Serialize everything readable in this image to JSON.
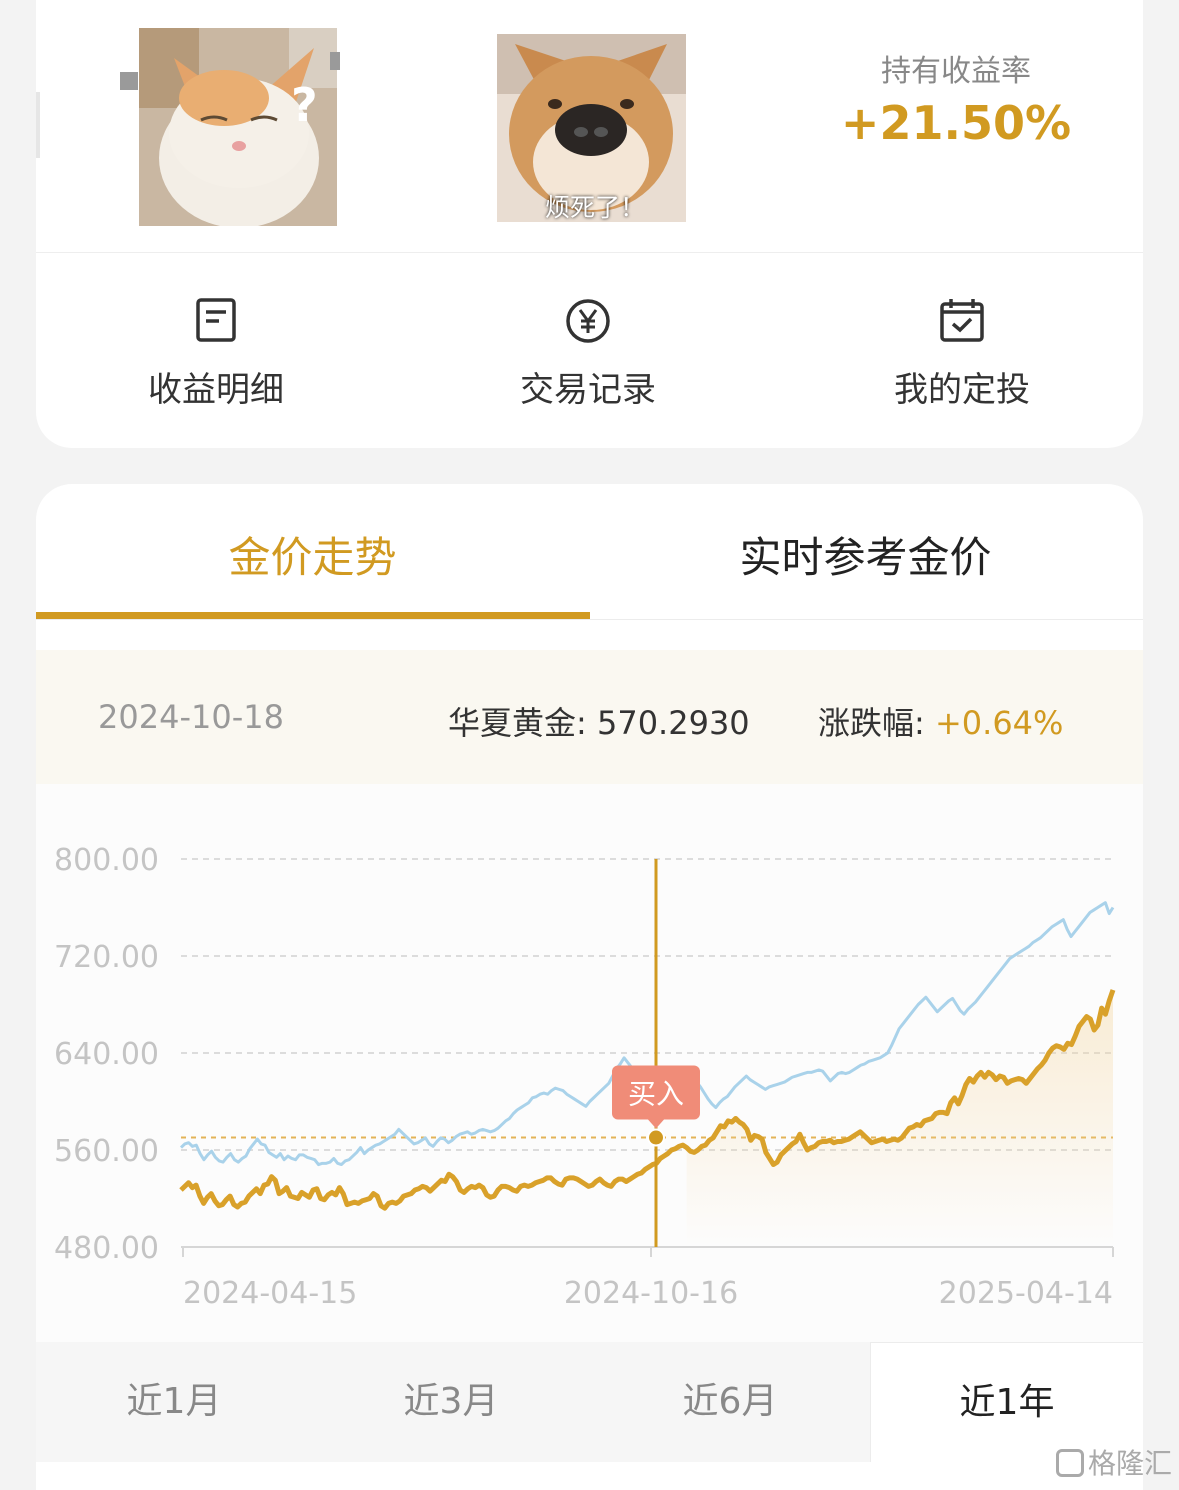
{
  "header": {
    "memes": [
      {
        "caption": "?"
      },
      {
        "caption": "烦死了！"
      }
    ],
    "return_label": "持有收益率",
    "return_value": "+21.50%"
  },
  "menu": {
    "items": [
      {
        "label": "收益明细",
        "icon": "document-icon"
      },
      {
        "label": "交易记录",
        "icon": "yen-circle-icon"
      },
      {
        "label": "我的定投",
        "icon": "calendar-check-icon"
      }
    ]
  },
  "tabs": [
    {
      "label": "金价走势",
      "active": true
    },
    {
      "label": "实时参考金价",
      "active": false
    }
  ],
  "info": {
    "date": "2024-10-18",
    "fund_label": "华夏黄金:",
    "fund_value": "570.2930",
    "change_label": "涨跌幅:",
    "change_value": "+0.64%"
  },
  "chart_data": {
    "type": "line",
    "y_ticks": [
      "800.00",
      "720.00",
      "640.00",
      "560.00",
      "480.00"
    ],
    "ylim": [
      480,
      800
    ],
    "x_labels": [
      "2024-04-15",
      "2024-10-16",
      "2025-04-14"
    ],
    "buy_label": "买入",
    "buy_point": {
      "x": "2024-10-18",
      "y": 570.29
    },
    "reference_line": 570.29,
    "colors": {
      "main": "#d9a12a",
      "secondary": "#a9d2ea",
      "buy": "#f08c78"
    },
    "series": [
      {
        "key": "main",
        "values": [
          527,
          530,
          533,
          529,
          531,
          522,
          516,
          521,
          524,
          518,
          514,
          515,
          519,
          522,
          515,
          513,
          516,
          517,
          522,
          525,
          528,
          524,
          531,
          532,
          538,
          535,
          524,
          526,
          529,
          522,
          521,
          520,
          525,
          523,
          521,
          527,
          528,
          520,
          519,
          523,
          525,
          523,
          529,
          524,
          515,
          516,
          517,
          516,
          518,
          519,
          520,
          524,
          522,
          514,
          512,
          516,
          517,
          516,
          518,
          522,
          523,
          524,
          527,
          528,
          530,
          529,
          526,
          529,
          532,
          535,
          534,
          540,
          538,
          534,
          527,
          525,
          528,
          530,
          529,
          531,
          529,
          523,
          521,
          522,
          527,
          530,
          530,
          529,
          527,
          526,
          530,
          531,
          530,
          531,
          533,
          534,
          535,
          537,
          537,
          534,
          532,
          531,
          536,
          537,
          537,
          536,
          534,
          532,
          530,
          531,
          534,
          536,
          533,
          531,
          530,
          534,
          536,
          536,
          534,
          536,
          538,
          540,
          541,
          544,
          546,
          548,
          549,
          553,
          555,
          557,
          560,
          561,
          563,
          564,
          562,
          559,
          558,
          560,
          563,
          564,
          568,
          570,
          575,
          580,
          579,
          584,
          583,
          586,
          583,
          581,
          577,
          568,
          572,
          571,
          569,
          558,
          553,
          548,
          550,
          556,
          559,
          562,
          565,
          567,
          573,
          566,
          560,
          562,
          563,
          566,
          567,
          567,
          568,
          566,
          567,
          567,
          568,
          569,
          571,
          573,
          575,
          572,
          569,
          566,
          567,
          568,
          569,
          567,
          568,
          569,
          568,
          570,
          574,
          578,
          579,
          581,
          580,
          584,
          585,
          586,
          590,
          591,
          591,
          590,
          599,
          603,
          598,
          605,
          614,
          619,
          616,
          621,
          624,
          620,
          624,
          622,
          618,
          621,
          620,
          615,
          617,
          618,
          619,
          618,
          615,
          619,
          623,
          627,
          630,
          634,
          640,
          644,
          646,
          645,
          643,
          648,
          647,
          654,
          662,
          666,
          670,
          668,
          659,
          663,
          677,
          672,
          683,
          692
        ]
      },
      {
        "key": "secondary",
        "values": [
          562,
          565,
          566,
          563,
          564,
          557,
          552,
          556,
          559,
          554,
          551,
          550,
          554,
          557,
          552,
          550,
          553,
          555,
          561,
          565,
          569,
          565,
          564,
          558,
          556,
          554,
          557,
          552,
          555,
          553,
          552,
          556,
          556,
          554,
          553,
          552,
          548,
          549,
          549,
          550,
          553,
          549,
          548,
          551,
          552,
          555,
          558,
          562,
          557,
          560,
          562,
          564,
          565,
          567,
          569,
          571,
          573,
          577,
          574,
          571,
          568,
          565,
          566,
          568,
          570,
          565,
          563,
          567,
          570,
          569,
          566,
          568,
          571,
          573,
          574,
          575,
          573,
          574,
          576,
          577,
          576,
          575,
          576,
          578,
          581,
          584,
          586,
          590,
          593,
          595,
          597,
          599,
          603,
          604,
          606,
          607,
          606,
          609,
          611,
          610,
          609,
          606,
          604,
          602,
          600,
          598,
          596,
          600,
          603,
          606,
          609,
          612,
          615,
          621,
          627,
          631,
          636,
          632,
          628,
          625,
          623,
          620,
          617,
          614,
          611,
          608,
          605,
          603,
          605,
          607,
          608,
          612,
          615,
          618,
          620,
          616,
          612,
          607,
          602,
          598,
          595,
          599,
          602,
          604,
          608,
          612,
          615,
          618,
          621,
          618,
          616,
          614,
          612,
          610,
          612,
          613,
          614,
          615,
          616,
          618,
          620,
          621,
          622,
          623,
          624,
          624,
          625,
          626,
          625,
          621,
          617,
          620,
          623,
          624,
          623,
          624,
          626,
          628,
          630,
          631,
          633,
          634,
          635,
          636,
          638,
          640,
          646,
          653,
          660,
          664,
          668,
          672,
          676,
          680,
          683,
          686,
          682,
          678,
          674,
          677,
          680,
          683,
          685,
          680,
          675,
          672,
          676,
          679,
          682,
          686,
          690,
          694,
          698,
          702,
          706,
          710,
          714,
          718,
          720,
          722,
          724,
          726,
          728,
          731,
          733,
          735,
          738,
          741,
          744,
          746,
          748,
          750,
          742,
          736,
          740,
          744,
          748,
          752,
          756,
          758,
          760,
          762,
          764,
          755,
          760
        ]
      }
    ]
  },
  "periods": [
    {
      "label": "近1月",
      "active": false
    },
    {
      "label": "近3月",
      "active": false
    },
    {
      "label": "近6月",
      "active": false
    },
    {
      "label": "近1年",
      "active": true
    }
  ],
  "watermark": "格隆汇"
}
